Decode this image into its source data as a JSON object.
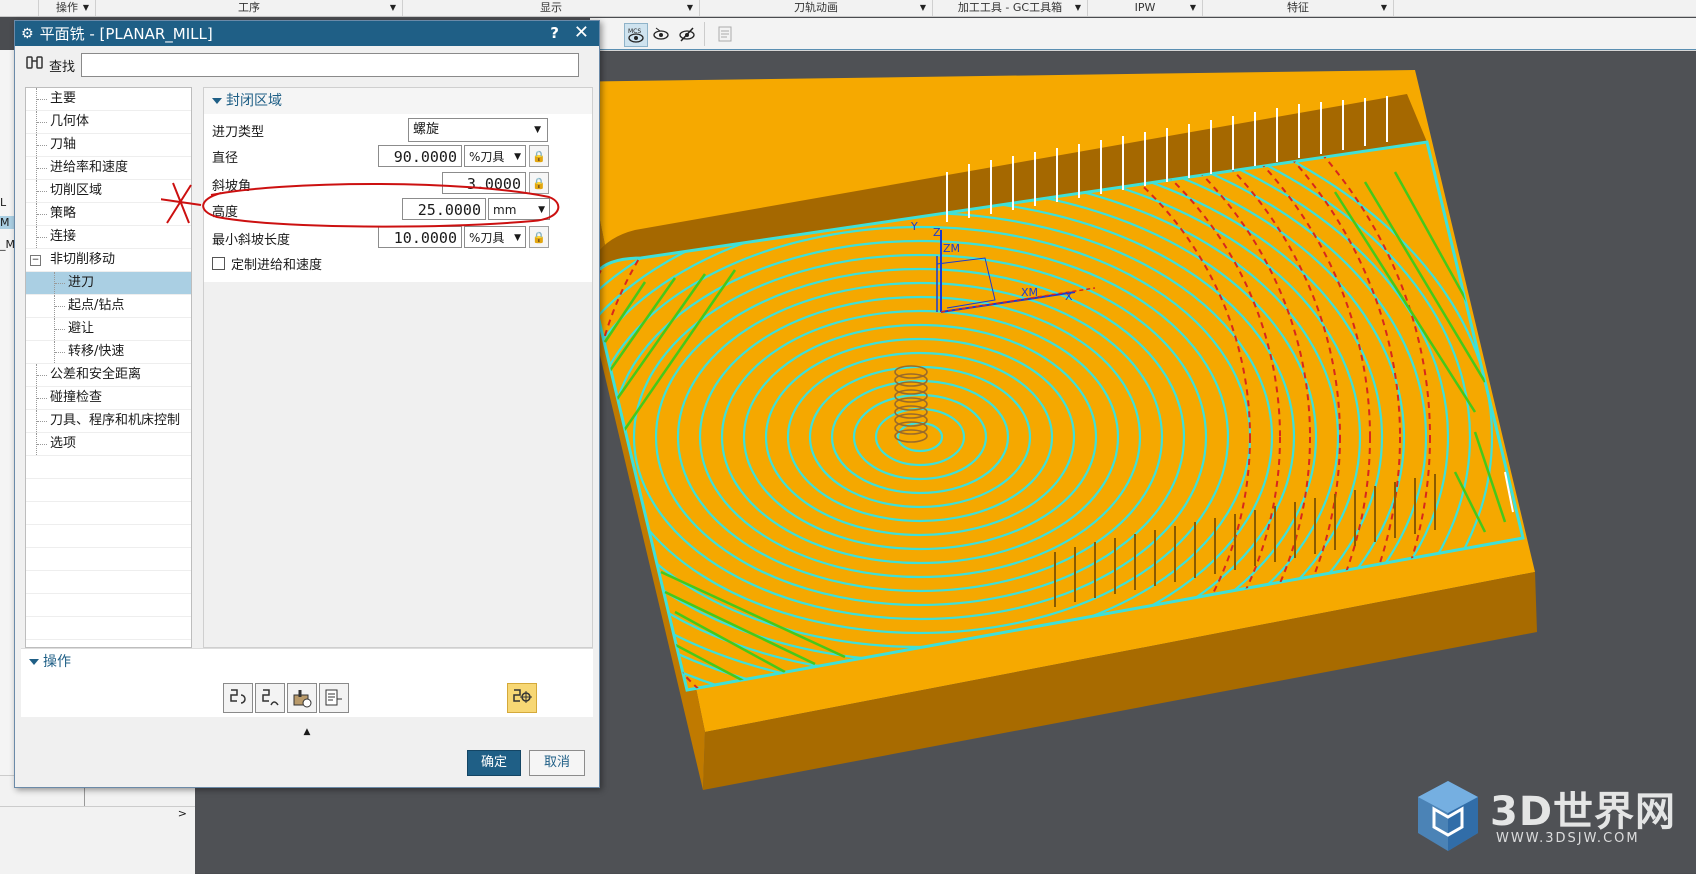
{
  "menubar": {
    "items": [
      {
        "label": "操作"
      },
      {
        "label": "工序"
      },
      {
        "label": "显示"
      },
      {
        "label": "刀轨动画"
      },
      {
        "label": "加工工具 - GC工具箱"
      },
      {
        "label": "IPW"
      },
      {
        "label": "特征"
      }
    ]
  },
  "left_strip": {
    "items": [
      "L",
      "M",
      "_M"
    ]
  },
  "dialog": {
    "title": "平面铣 - [PLANAR_MILL]",
    "help": "?",
    "close": "✕",
    "find_label": "查找",
    "find_value": "",
    "tree": [
      {
        "label": "主要",
        "level": 0
      },
      {
        "label": "几何体",
        "level": 0
      },
      {
        "label": "刀轴",
        "level": 0
      },
      {
        "label": "进给率和速度",
        "level": 0
      },
      {
        "label": "切削区域",
        "level": 0
      },
      {
        "label": "策略",
        "level": 0
      },
      {
        "label": "连接",
        "level": 0
      },
      {
        "label": "非切削移动",
        "level": 0,
        "expanded": true
      },
      {
        "label": "进刀",
        "level": 1,
        "selected": true
      },
      {
        "label": "起点/钻点",
        "level": 1
      },
      {
        "label": "避让",
        "level": 1
      },
      {
        "label": "转移/快速",
        "level": 1
      },
      {
        "label": "公差和安全距离",
        "level": 0
      },
      {
        "label": "碰撞检查",
        "level": 0
      },
      {
        "label": "刀具、程序和机床控制",
        "level": 0
      },
      {
        "label": "选项",
        "level": 0
      }
    ],
    "section_title": "封闭区域",
    "fields": {
      "entry_type": {
        "label": "进刀类型",
        "value": "螺旋"
      },
      "diameter": {
        "label": "直径",
        "value": "90.0000",
        "unit": "%刀具"
      },
      "ramp_angle": {
        "label": "斜坡角",
        "value": "3.0000"
      },
      "height": {
        "label": "高度",
        "value": "25.0000",
        "unit": "mm"
      },
      "min_ramp_length": {
        "label": "最小斜坡长度",
        "value": "10.0000",
        "unit": "%刀具"
      },
      "custom_feed": {
        "label": "定制进给和速度",
        "checked": false
      }
    },
    "ops_title": "操作",
    "ok_label": "确定",
    "cancel_label": "取消"
  },
  "viewport": {
    "axis_labels": {
      "y": "Y",
      "z": "Z",
      "zm": "ZM",
      "xm": "XM",
      "x": "X"
    }
  },
  "watermark": {
    "big": "3D世界网",
    "small": "WWW.3DSJW.COM"
  },
  "colors": {
    "title_bar": "#1f5f86",
    "part": "#f5a800",
    "toolpath_cyan": "#3fe0d8",
    "toolpath_green": "#46c81a",
    "toolpath_red": "#d8271c",
    "annotation_red": "#cc1010",
    "selection": "#aacfe3"
  }
}
